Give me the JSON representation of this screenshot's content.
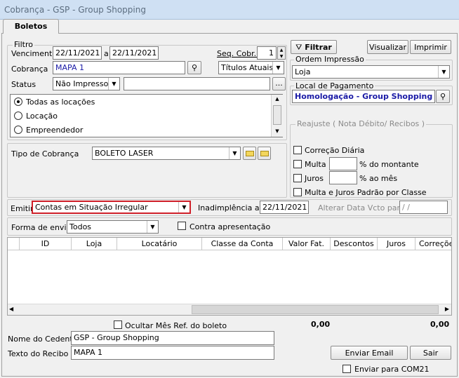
{
  "window": {
    "title": "Cobrança - GSP - Group Shopping"
  },
  "tabs": [
    {
      "label": "Boletos"
    }
  ],
  "filtro": {
    "legend": "Filtro",
    "vencimento_label": "Vencimento",
    "vencimento_de": "22/11/2021",
    "a_label": "a",
    "vencimento_ate": "22/11/2021",
    "seq_label": "Seq. Cobr.:",
    "seq_value": "1",
    "cobranca_label": "Cobrança",
    "cobranca_value": "MAPA 1",
    "titulos_value": "Títulos Atuais",
    "status_label": "Status",
    "status_value": "Não Impresso",
    "status_extra": "",
    "ellipsis": "...",
    "radio_options": [
      "Todas as locações",
      "Locação",
      "Empreendedor"
    ]
  },
  "toolbar": {
    "filtrar": "Filtrar",
    "visualizar": "Visualizar",
    "imprimir": "Imprimir"
  },
  "ordem": {
    "legend": "Ordem Impressão",
    "value": "Loja"
  },
  "local": {
    "legend": "Local de Pagamento",
    "value": "Homologação - Group Shopping"
  },
  "tipo_cobranca": {
    "label": "Tipo de Cobrança",
    "value": "BOLETO LASER"
  },
  "reajuste": {
    "legend": "Reajuste ( Nota Débito/ Recibos )",
    "correcao": "Correção Diária",
    "multa": "Multa",
    "multa_suffix": "% do montante",
    "juros": "Juros",
    "juros_suffix": "% ao mês",
    "padrao": "Multa e Juros Padrão por Classe"
  },
  "emitir": {
    "label": "Emitir",
    "value": "Contas em Situação Irregular",
    "inadimplencia_label": "Inadimplência até",
    "inadimplencia_value": "22/11/2021",
    "alterar_label": "Alterar Data Vcto para",
    "alterar_value": " / /"
  },
  "envio": {
    "label": "Forma de envio",
    "value": "Todos",
    "contra": "Contra apresentação"
  },
  "grid": {
    "columns": [
      "ID",
      "Loja",
      "Locatário",
      "Classe da Conta",
      "Valor Fat.",
      "Descontos",
      "Juros",
      "Correções"
    ]
  },
  "footer": {
    "ocultar": "Ocultar Mês Ref. do boleto",
    "total1": "0,00",
    "total2": "0,00",
    "cedente_label": "Nome do Cedente",
    "cedente_value": "GSP - Group Shopping",
    "recibo_label": "Texto do Recibo",
    "recibo_value": "MAPA 1",
    "enviar_email": "Enviar Email",
    "sair": "Sair",
    "com21": "Enviar para COM21"
  },
  "colors": {
    "accent_red": "#d0202a",
    "link_blue": "#1a1aa6"
  }
}
